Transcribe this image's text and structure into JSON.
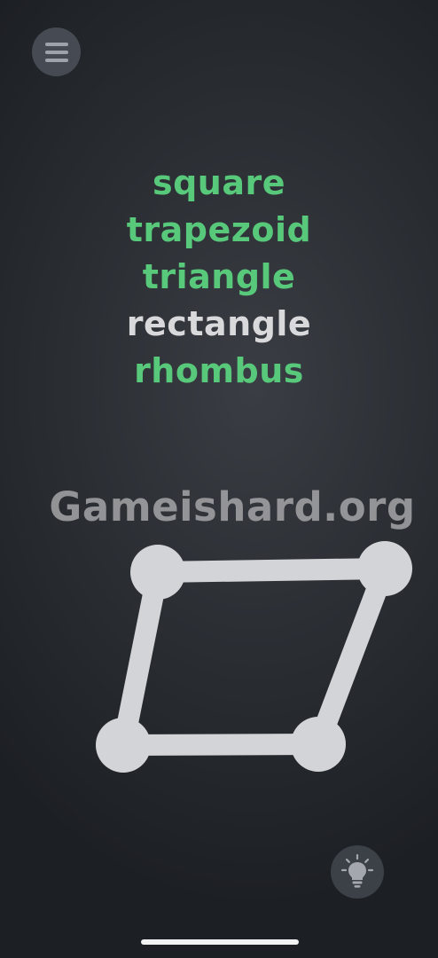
{
  "menu": {
    "icon": "hamburger-menu-icon"
  },
  "word_list": [
    {
      "text": "square",
      "color": "#58c97a",
      "found": true
    },
    {
      "text": "trapezoid",
      "color": "#58c97a",
      "found": true
    },
    {
      "text": "triangle",
      "color": "#58c97a",
      "found": true
    },
    {
      "text": "rectangle",
      "color": "#d9d9dc",
      "found": false
    },
    {
      "text": "rhombus",
      "color": "#58c97a",
      "found": true
    }
  ],
  "watermark": "Gameishard.org",
  "puzzle": {
    "node_color": "#d3d4d7",
    "edge_color": "#d3d4d7"
  },
  "hint": {
    "icon": "lightbulb-icon"
  },
  "colors": {
    "found_word": "#58c97a",
    "pending_word": "#d9d9dc",
    "background": "#2b2f34"
  }
}
